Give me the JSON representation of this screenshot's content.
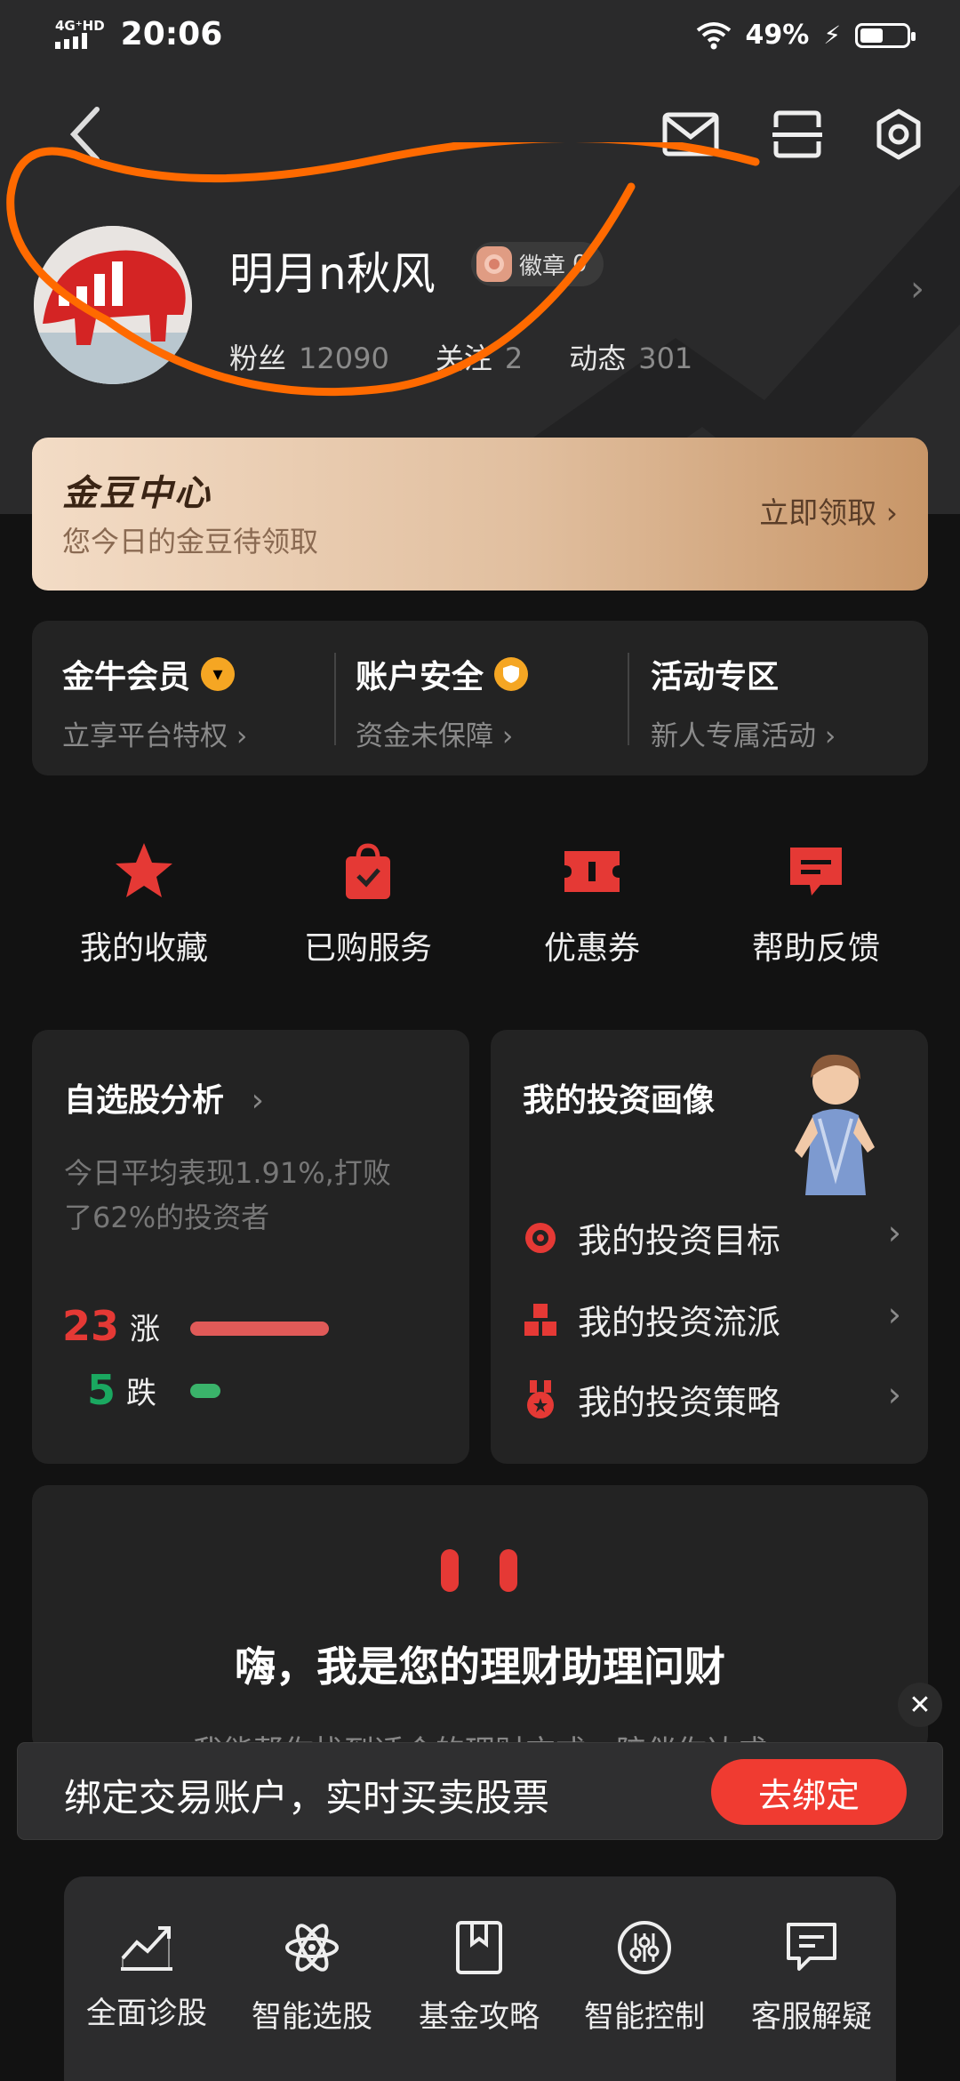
{
  "status_bar": {
    "network": "4G⁺HD",
    "time": "20:06",
    "battery": "49%",
    "battery_level": 0.49
  },
  "profile": {
    "username": "明月n秋风",
    "medal_label": "徽章",
    "medal_count": "0",
    "stats": [
      {
        "label": "粉丝",
        "value": "12090"
      },
      {
        "label": "关注",
        "value": "2"
      },
      {
        "label": "动态",
        "value": "301"
      }
    ]
  },
  "coin_center": {
    "title": "金豆中心",
    "subtitle": "您今日的金豆待领取",
    "action": "立即领取"
  },
  "member_row": [
    {
      "title": "金牛会员",
      "subtitle": "立享平台特权"
    },
    {
      "title": "账户安全",
      "subtitle": "资金未保障"
    },
    {
      "title": "活动专区",
      "subtitle": "新人专属活动"
    }
  ],
  "quick_actions": [
    {
      "label": "我的收藏",
      "icon": "star-icon"
    },
    {
      "label": "已购服务",
      "icon": "shopping-bag-icon"
    },
    {
      "label": "优惠券",
      "icon": "coupon-icon"
    },
    {
      "label": "帮助反馈",
      "icon": "message-icon"
    }
  ],
  "watchlist": {
    "title": "自选股分析",
    "desc_line1": "今日平均表现1.91%,打败",
    "desc_line2": "了62%的投资者",
    "up_count": "23",
    "up_label": "涨",
    "down_count": "5",
    "down_label": "跌"
  },
  "portrait": {
    "title": "我的投资画像",
    "items": [
      {
        "label": "我的投资目标",
        "icon": "target-icon"
      },
      {
        "label": "我的投资流派",
        "icon": "cubes-icon"
      },
      {
        "label": "我的投资策略",
        "icon": "medal-icon"
      }
    ]
  },
  "assistant": {
    "title": "嗨，我是您的理财助理问财",
    "subtitle": "我能帮你找到适合的理财方式，陪伴你达成"
  },
  "bind_banner": {
    "text": "绑定交易账户，实时买卖股票",
    "button": "去绑定"
  },
  "tools": [
    {
      "label": "全面诊股",
      "icon": "chart-trend-icon"
    },
    {
      "label": "智能选股",
      "icon": "atom-icon"
    },
    {
      "label": "基金攻略",
      "icon": "bookmark-book-icon"
    },
    {
      "label": "智能控制",
      "icon": "sliders-icon"
    },
    {
      "label": "客服解疑",
      "icon": "chat-icon"
    }
  ],
  "colors": {
    "accent_red": "#e53935",
    "up_red": "#e05a58",
    "down_green": "#3ab36a",
    "annotation_orange": "#ff6a00"
  }
}
